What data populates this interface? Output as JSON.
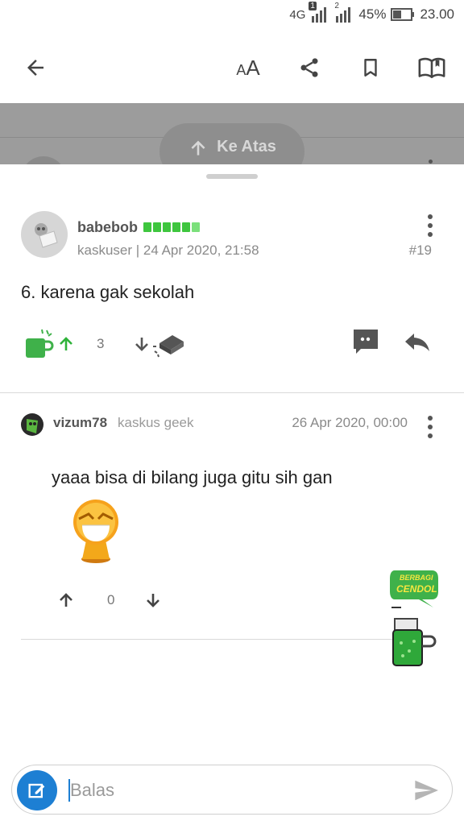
{
  "status_bar": {
    "network": "4G",
    "sim1": "1",
    "sim2": "2",
    "battery_percent": "45%",
    "time": "23.00",
    "icons": [
      "signal-icon",
      "battery-icon"
    ]
  },
  "app_bar": {
    "icons": [
      "back-arrow-icon",
      "text-size-icon",
      "share-icon",
      "bookmark-icon",
      "book-icon"
    ],
    "text_size_small": "A",
    "text_size_large": "A"
  },
  "overlay": {
    "scroll_top_label": "Ke Atas"
  },
  "posts": [
    {
      "username": "babebob",
      "reputation_level": 6,
      "meta": "kaskuser | 24 Apr 2020, 21:58",
      "post_number": "#19",
      "body": "6. karena gak sekolah",
      "vote_count": "3",
      "icons": [
        "cendol-icon",
        "upvote-icon",
        "downvote-icon",
        "bata-icon",
        "quote-icon",
        "reply-icon",
        "more-vert-icon"
      ]
    }
  ],
  "comments": [
    {
      "username": "vizum78",
      "rank": "kaskus geek",
      "date": "26 Apr 2020, 00:00",
      "body": "yaaa bisa di bilang juga gitu sih gan",
      "vote_count": "0",
      "icons": [
        "avatar-icon",
        "emoji-icon",
        "upvote-icon",
        "downvote-icon",
        "more-vert-icon"
      ]
    }
  ],
  "promo": {
    "badge_line1": "BERBAGI",
    "badge_line2": "CENDOL"
  },
  "reply": {
    "placeholder": "Balas",
    "icons": [
      "edit-icon",
      "send-icon"
    ]
  },
  "colors": {
    "reputation_green": "#3ec63e",
    "accent_blue": "#1d7fd3",
    "upvote_green": "#2fb33a",
    "overlay_gray": "#9c9c9c"
  }
}
